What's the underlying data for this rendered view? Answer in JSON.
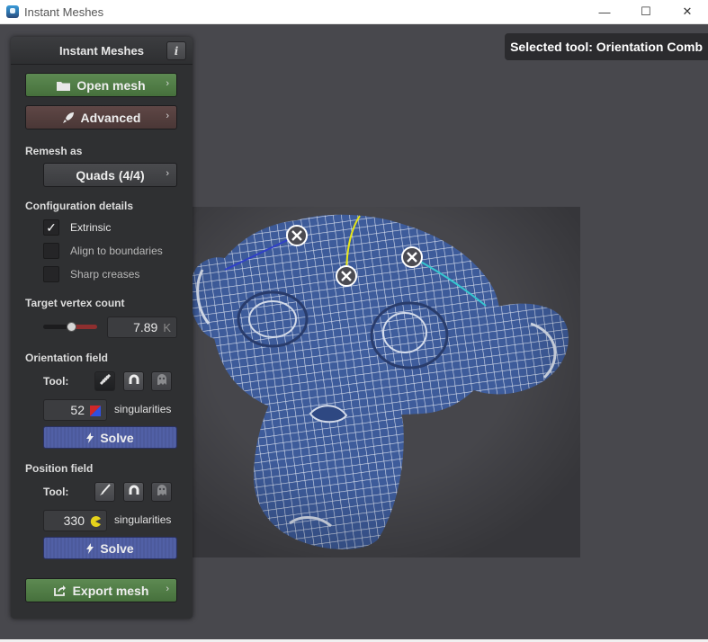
{
  "window": {
    "title": "Instant Meshes",
    "minimize": "—",
    "maximize": "☐",
    "close": "✕"
  },
  "viewport": {
    "tool_indicator": "Selected tool: Orientation Comb",
    "accent_mesh": "#3e5c9e",
    "accent_edges": [
      "#3040c8",
      "#e6e619",
      "#35c8d0"
    ]
  },
  "panel": {
    "title": "Instant Meshes",
    "info_label": "i",
    "open_mesh": "Open mesh",
    "advanced": "Advanced",
    "chevron": "›",
    "remesh_as_label": "Remesh as",
    "remesh_as_value": "Quads (4/4)",
    "config_label": "Configuration details",
    "options": [
      {
        "label": "Extrinsic",
        "checked": true
      },
      {
        "label": "Align to boundaries",
        "checked": false
      },
      {
        "label": "Sharp creases",
        "checked": false
      }
    ],
    "vertex_count_label": "Target vertex count",
    "vertex_count_value": "7.89",
    "vertex_count_unit": "K",
    "vertex_count_slider": 0.5,
    "orientation_label": "Orientation field",
    "tool_label": "Tool:",
    "orientation_singularities": "52",
    "singularities_label": "singularities",
    "solve_label": "Solve",
    "position_label": "Position field",
    "position_singularities": "330",
    "export_mesh": "Export mesh",
    "colors": {
      "green_button": "#527d47",
      "red_button": "#553f3e",
      "blue_button": "#5060a2"
    }
  }
}
